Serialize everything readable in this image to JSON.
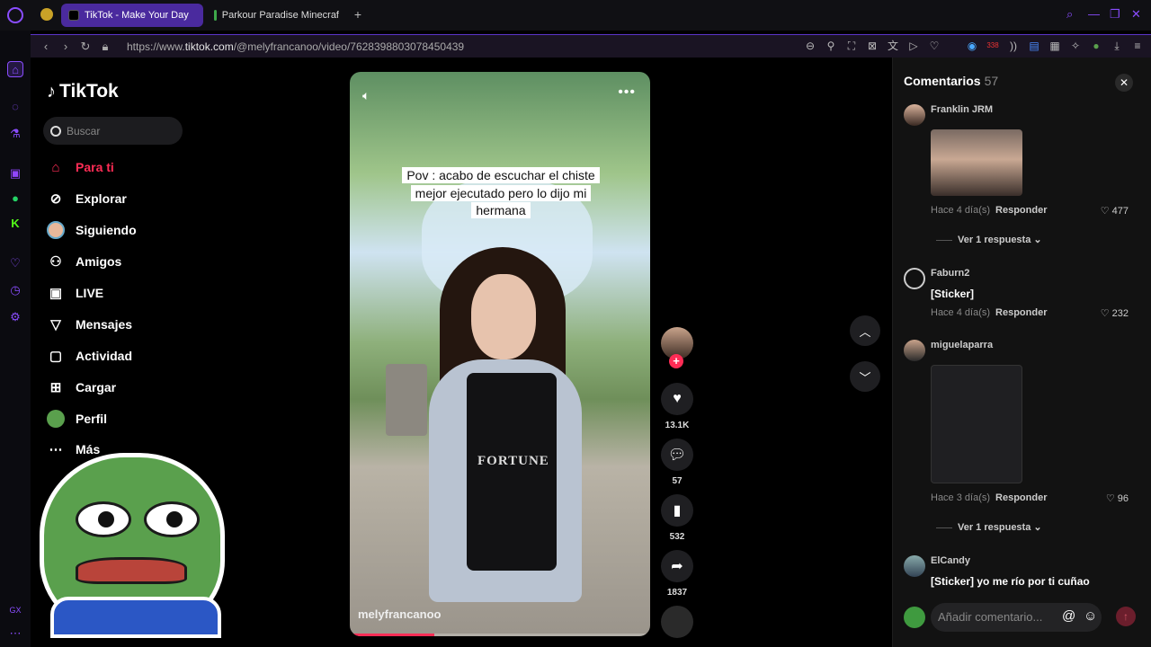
{
  "browser": {
    "tabs": [
      {
        "title": "TikTok - Make Your Day",
        "active": true
      },
      {
        "title": "Parkour Paradise Minecraf",
        "active": false
      }
    ],
    "url_prefix": "https://www.",
    "url_host": "tiktok.com",
    "url_path": "/@melyfrancanoo/video/7628398803078450439",
    "badge_count": "338"
  },
  "tiktok": {
    "logo": "TikTok",
    "search_placeholder": "Buscar",
    "nav": [
      {
        "label": "Para ti",
        "icon": "home-icon",
        "active": true
      },
      {
        "label": "Explorar",
        "icon": "compass-icon",
        "active": false
      },
      {
        "label": "Siguiendo",
        "icon": "following-avatar-icon",
        "active": false
      },
      {
        "label": "Amigos",
        "icon": "friends-icon",
        "active": false
      },
      {
        "label": "LIVE",
        "icon": "live-icon",
        "active": false
      },
      {
        "label": "Mensajes",
        "icon": "send-icon",
        "active": false
      },
      {
        "label": "Actividad",
        "icon": "activity-icon",
        "active": false
      },
      {
        "label": "Cargar",
        "icon": "upload-icon",
        "active": false
      },
      {
        "label": "Perfil",
        "icon": "profile-avatar-icon",
        "active": false
      }
    ],
    "nav_more_partial": "Más"
  },
  "video": {
    "caption": "Pov : acabo de escuchar el chiste mejor ejecutado pero lo dijo mi hermana",
    "author": "melyfrancanoo",
    "shirt_text": "FORTUNE",
    "progress": 0.28
  },
  "actions": {
    "likes": "13.1K",
    "comments": "57",
    "saves": "532",
    "shares": "1837"
  },
  "comments_panel": {
    "title": "Comentarios",
    "count": "57",
    "reply_label": "Responder",
    "input_placeholder": "Añadir comentario...",
    "items": [
      {
        "user": "Franklin JRM",
        "text": "",
        "time": "Hace 4 día(s)",
        "likes": "477",
        "replies": "Ver 1 respuesta",
        "has_image": true
      },
      {
        "user": "Faburn2",
        "text": "[Sticker]",
        "time": "Hace 4 día(s)",
        "likes": "232",
        "replies": "",
        "has_image": false
      },
      {
        "user": "miguelaparra",
        "text": "",
        "time": "Hace 3 día(s)",
        "likes": "96",
        "replies": "Ver 1 respuesta",
        "has_image": true
      },
      {
        "user": "ElCandy",
        "text": "[Sticker] yo me río por ti cuñao",
        "time": "",
        "likes": "",
        "replies": "",
        "has_image": false
      }
    ]
  },
  "colors": {
    "accent": "#fe2c55",
    "browser_accent": "#8a4dff"
  }
}
